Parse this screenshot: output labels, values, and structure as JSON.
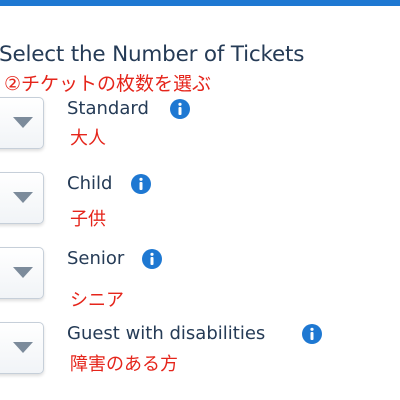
{
  "section_title": "Select the Number of Tickets",
  "step_annotation": "②チケットの枚数を選ぶ",
  "ticket_types": [
    {
      "label": "Standard",
      "annotation": "大人"
    },
    {
      "label": "Child",
      "annotation": "子供"
    },
    {
      "label": "Senior",
      "annotation": "シニア"
    },
    {
      "label": "Guest with disabilities",
      "annotation": "障害のある方"
    }
  ],
  "icons": {
    "quantity_dropdown": "chevron-down-icon",
    "info": "info-icon"
  },
  "colors": {
    "top_bar": "#1e78d2",
    "title_text": "#253b56",
    "annotation": "#e5251b",
    "info_icon": "#1e78d2",
    "dropdown_arrow": "#7c8b9b"
  }
}
